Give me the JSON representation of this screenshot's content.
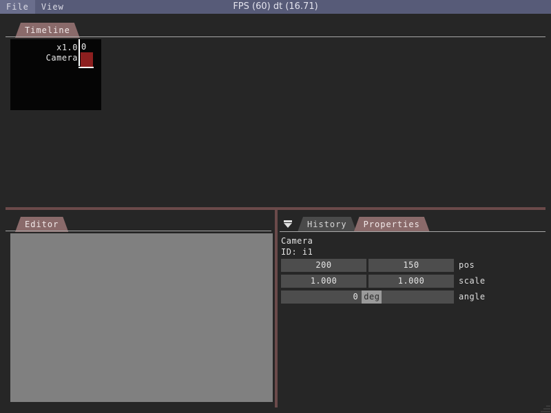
{
  "window": {
    "background": "#262626",
    "status_text": "FPS (60) dt (16.71)"
  },
  "menubar": {
    "background": "#575b78",
    "items": [
      {
        "label": "File"
      },
      {
        "label": "View"
      }
    ]
  },
  "timeline_panel": {
    "tabs": [
      {
        "label": "Timeline",
        "active": true
      }
    ],
    "zoom_label": "x1.0",
    "playhead_label": "0",
    "tracks": [
      {
        "label": "Camera",
        "clip_color": "#8d1f1f"
      }
    ]
  },
  "editor_panel": {
    "tabs": [
      {
        "label": "Editor",
        "active": true
      }
    ],
    "canvas_color": "#808080"
  },
  "properties_panel": {
    "menu_icon": "collapse-triangle-icon",
    "tabs": [
      {
        "label": "History",
        "active": false
      },
      {
        "label": "Properties",
        "active": true
      }
    ],
    "object_name": "Camera",
    "object_id": "ID: i1",
    "rows": [
      {
        "label": "pos",
        "fields": [
          {
            "value": "200",
            "unit": ""
          },
          {
            "value": "150",
            "unit": ""
          }
        ]
      },
      {
        "label": "scale",
        "fields": [
          {
            "value": "1.000",
            "unit": ""
          },
          {
            "value": "1.000",
            "unit": ""
          }
        ]
      },
      {
        "label": "angle",
        "fields": [
          {
            "value": "0",
            "unit": "deg"
          }
        ]
      }
    ]
  },
  "colors": {
    "tab_active": "#8a6a6a",
    "tab_inactive": "#4a4a4a",
    "splitter": "#6b4a4a",
    "field": "#4d4d4d",
    "unit_chip": "#9a9a9a"
  }
}
